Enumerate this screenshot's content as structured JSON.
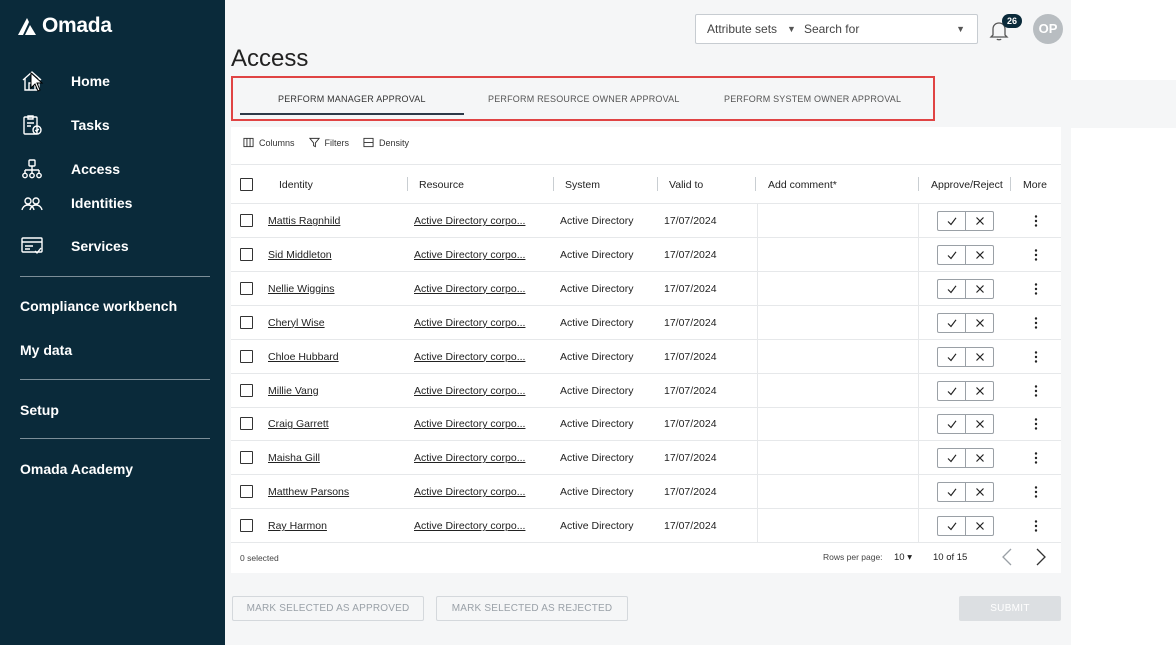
{
  "brand": {
    "name": "Omada"
  },
  "sidebar": {
    "items": [
      {
        "label": "Home"
      },
      {
        "label": "Tasks"
      },
      {
        "label": "Access"
      },
      {
        "label": "Identities"
      },
      {
        "label": "Services"
      }
    ],
    "sections": [
      {
        "label": "Compliance workbench"
      },
      {
        "label": "My data"
      },
      {
        "label": "Setup"
      },
      {
        "label": "Omada Academy"
      }
    ]
  },
  "header": {
    "attribute_sets": "Attribute sets",
    "search_placeholder": "Search for",
    "notifications_count": "26",
    "avatar_initials": "OP"
  },
  "page": {
    "title": "Access"
  },
  "tabs": [
    {
      "label": "PERFORM MANAGER APPROVAL"
    },
    {
      "label": "PERFORM RESOURCE OWNER APPROVAL"
    },
    {
      "label": "PERFORM SYSTEM OWNER APPROVAL"
    }
  ],
  "toolbar": {
    "columns": "Columns",
    "filters": "Filters",
    "density": "Density"
  },
  "table": {
    "headers": {
      "identity": "Identity",
      "resource": "Resource",
      "system": "System",
      "valid_to": "Valid to",
      "add_comment": "Add comment*",
      "approve_reject": "Approve/Reject",
      "more": "More"
    },
    "rows": [
      {
        "identity": "Mattis Ragnhild",
        "resource": "Active Directory corpo...",
        "system": "Active Directory",
        "valid_to": "17/07/2024"
      },
      {
        "identity": "Sid Middleton",
        "resource": "Active Directory corpo...",
        "system": "Active Directory",
        "valid_to": "17/07/2024"
      },
      {
        "identity": "Nellie Wiggins",
        "resource": "Active Directory corpo...",
        "system": "Active Directory",
        "valid_to": "17/07/2024"
      },
      {
        "identity": "Cheryl Wise",
        "resource": "Active Directory corpo...",
        "system": "Active Directory",
        "valid_to": "17/07/2024"
      },
      {
        "identity": "Chloe Hubbard",
        "resource": "Active Directory corpo...",
        "system": "Active Directory",
        "valid_to": "17/07/2024"
      },
      {
        "identity": "Millie Vang",
        "resource": "Active Directory corpo...",
        "system": "Active Directory",
        "valid_to": "17/07/2024"
      },
      {
        "identity": "Craig Garrett",
        "resource": "Active Directory corpo...",
        "system": "Active Directory",
        "valid_to": "17/07/2024"
      },
      {
        "identity": "Maisha Gill",
        "resource": "Active Directory corpo...",
        "system": "Active Directory",
        "valid_to": "17/07/2024"
      },
      {
        "identity": "Matthew Parsons",
        "resource": "Active Directory corpo...",
        "system": "Active Directory",
        "valid_to": "17/07/2024"
      },
      {
        "identity": "Ray Harmon",
        "resource": "Active Directory corpo...",
        "system": "Active Directory",
        "valid_to": "17/07/2024"
      }
    ]
  },
  "footer": {
    "selected": "0 selected",
    "rows_per_page_label": "Rows per page:",
    "rows_per_page_value": "10 ▾",
    "page_info": "10 of 15"
  },
  "actions": {
    "approve_selected": "MARK SELECTED AS APPROVED",
    "reject_selected": "MARK SELECTED AS REJECTED",
    "submit": "SUBMIT"
  }
}
